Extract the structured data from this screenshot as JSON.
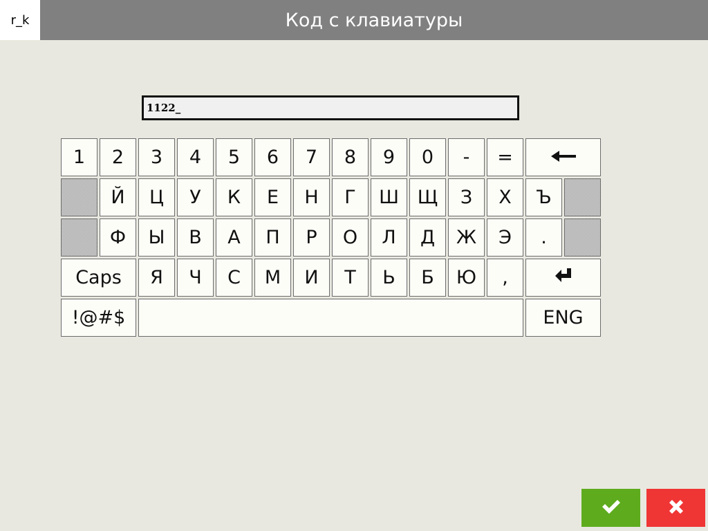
{
  "header": {
    "logo": "r_k",
    "title": "Код с клавиатуры"
  },
  "input": {
    "value": "1122_"
  },
  "keyboard": {
    "row1": [
      "1",
      "2",
      "3",
      "4",
      "5",
      "6",
      "7",
      "8",
      "9",
      "0",
      "-",
      "="
    ],
    "row2": [
      "Й",
      "Ц",
      "У",
      "К",
      "Е",
      "Н",
      "Г",
      "Ш",
      "Щ",
      "З",
      "Х",
      "Ъ"
    ],
    "row3": [
      "Ф",
      "Ы",
      "В",
      "А",
      "П",
      "Р",
      "О",
      "Л",
      "Д",
      "Ж",
      "Э",
      "."
    ],
    "row4": [
      "Я",
      "Ч",
      "С",
      "М",
      "И",
      "Т",
      "Ь",
      "Б",
      "Ю",
      ","
    ],
    "caps_label": "Caps",
    "symbols_label": "!@#$",
    "space_label": "",
    "lang_label": "ENG",
    "backspace_icon": "backspace-arrow-icon",
    "enter_icon": "enter-return-icon"
  },
  "actions": {
    "ok_icon": "checkmark-icon",
    "ok_color": "#5eab1e",
    "cancel_icon": "close-x-icon",
    "cancel_color": "#f03535"
  }
}
